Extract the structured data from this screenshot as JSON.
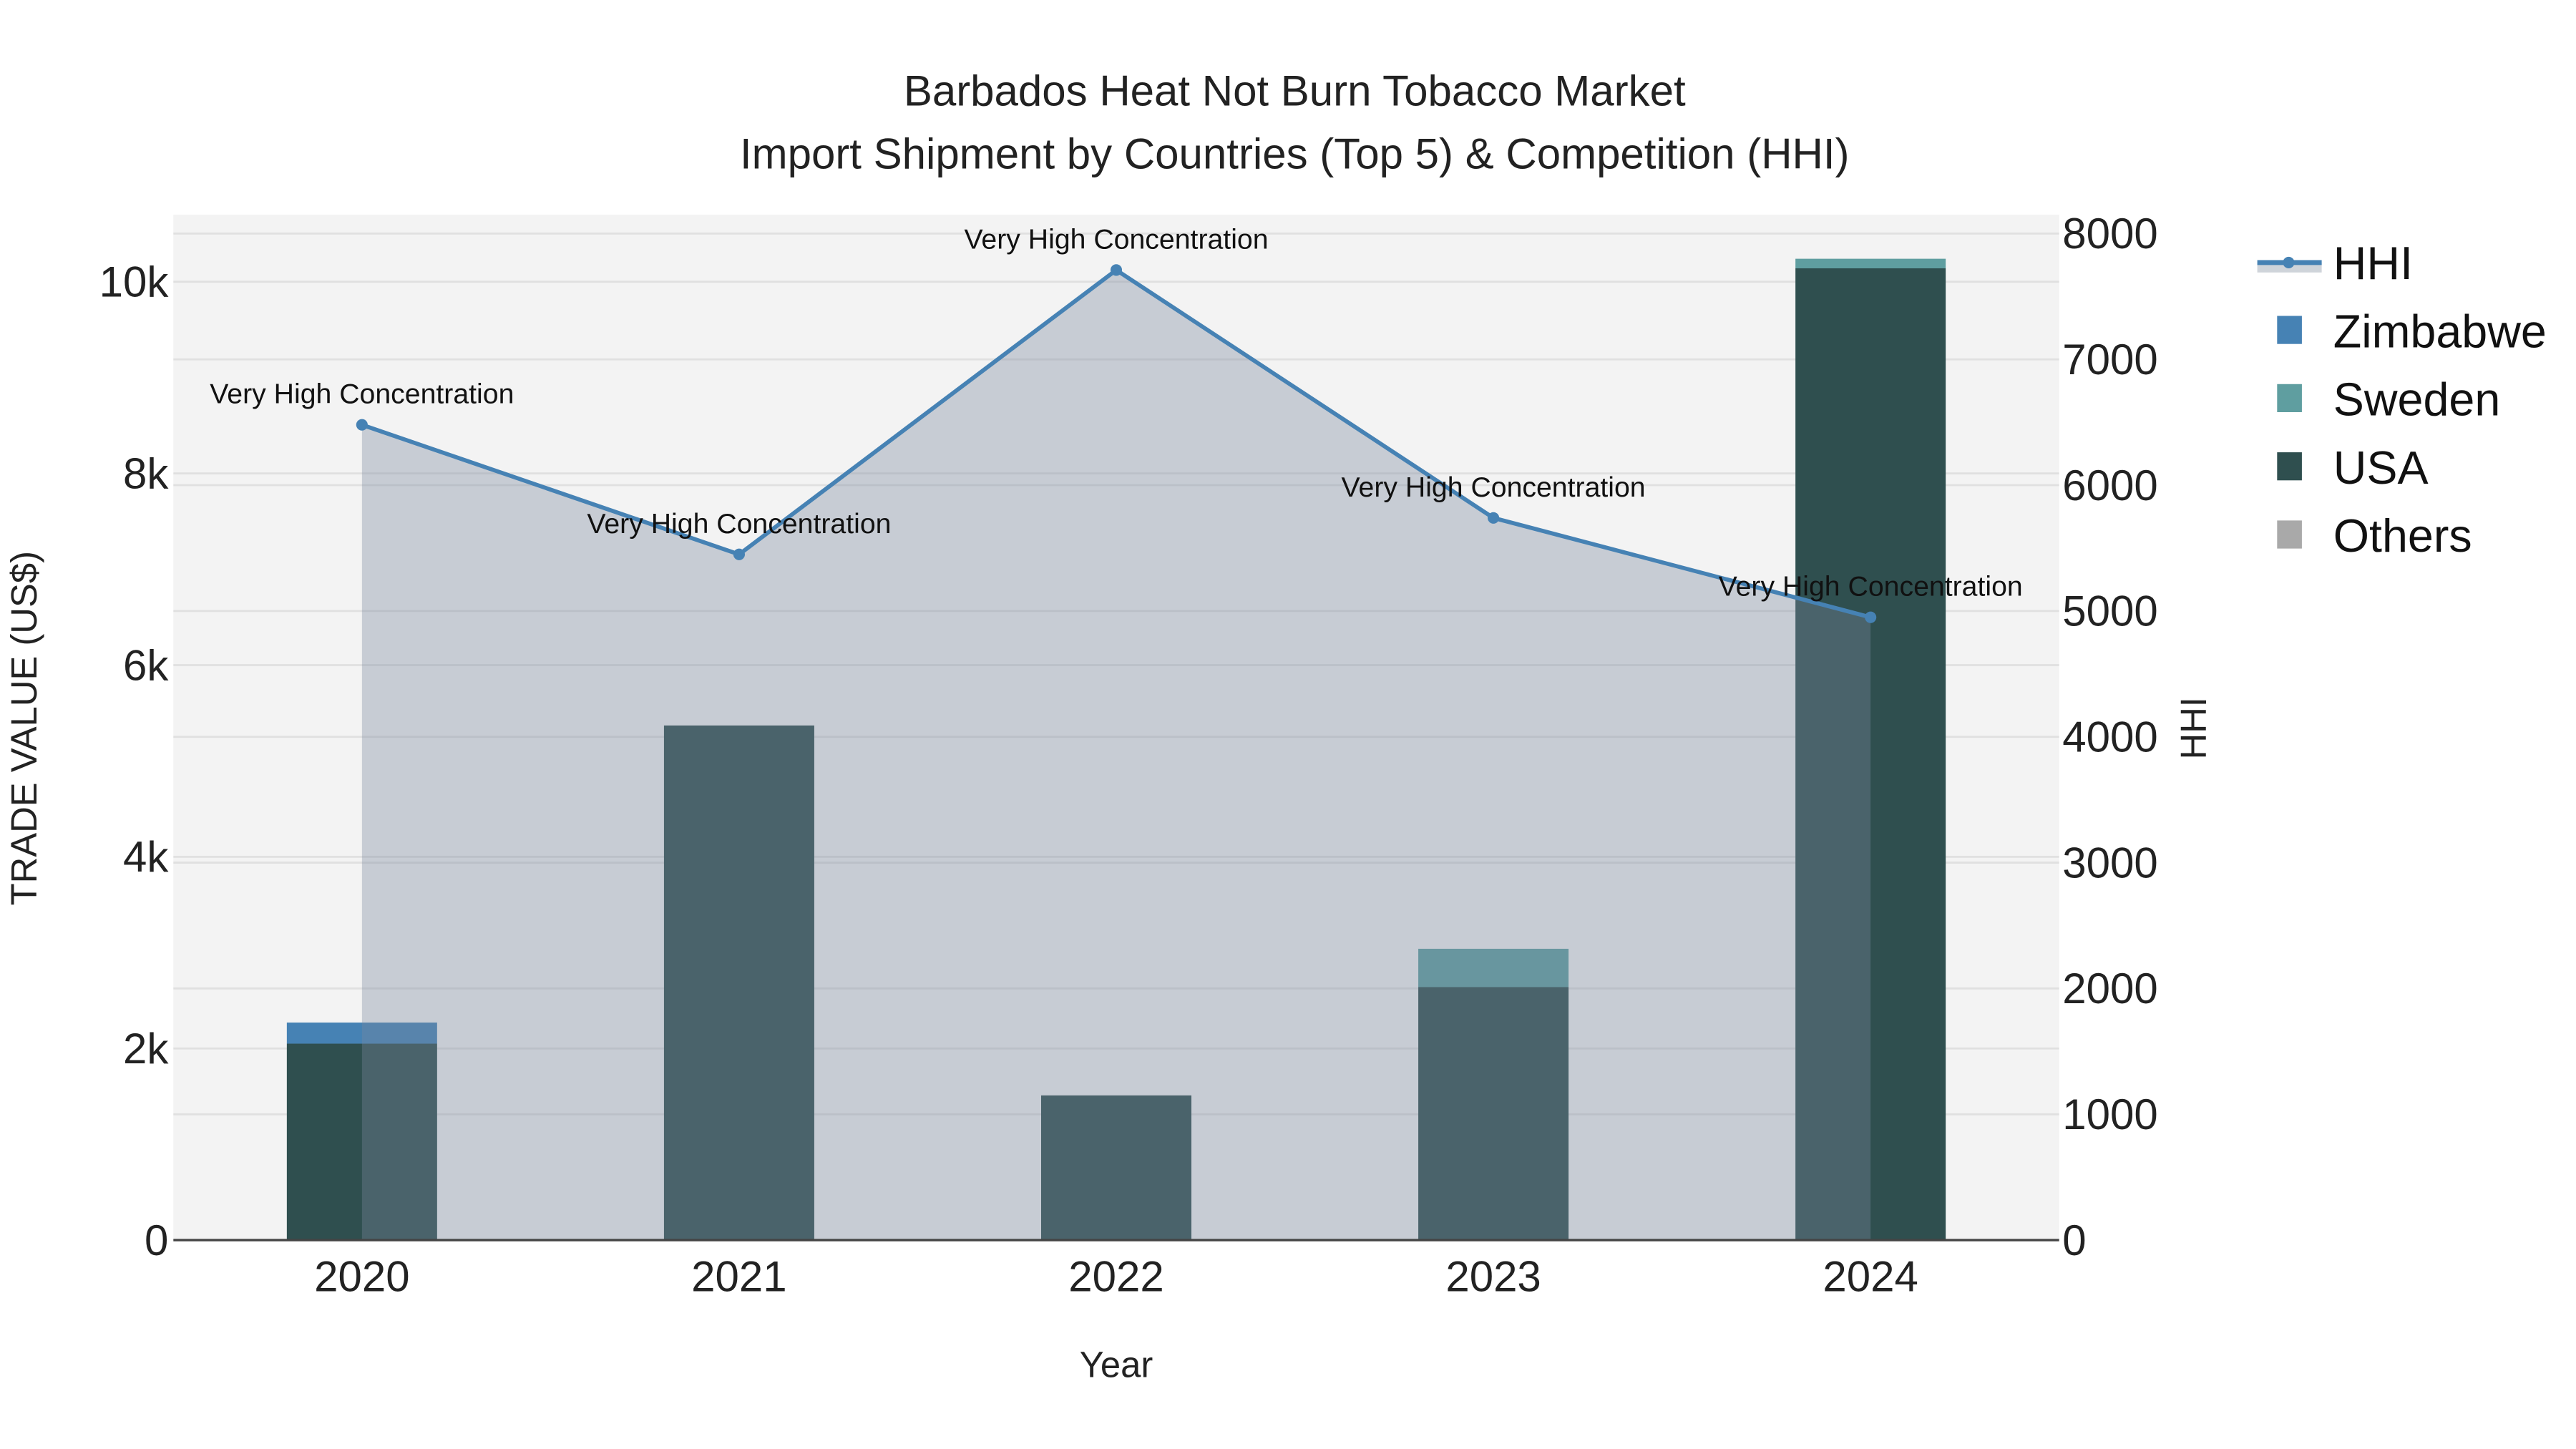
{
  "chart_data": {
    "type": "bar",
    "title_line1": "Barbados Heat Not Burn Tobacco Market",
    "title_line2": "Import Shipment by Countries (Top 5) & Competition (HHI)",
    "xlabel": "Year",
    "ylabel": "TRADE VALUE (US$)",
    "y2label": "HHI",
    "categories": [
      "2020",
      "2021",
      "2022",
      "2023",
      "2024"
    ],
    "ylim": [
      0,
      10700
    ],
    "y_ticks": [
      0,
      2000,
      4000,
      6000,
      8000,
      10000
    ],
    "y_tick_labels": [
      "0",
      "2k",
      "4k",
      "6k",
      "8k",
      "10k"
    ],
    "y2lim": [
      0,
      8150
    ],
    "y2_ticks": [
      0,
      1000,
      2000,
      3000,
      4000,
      5000,
      6000,
      7000,
      8000
    ],
    "y2_tick_labels": [
      "0",
      "1000",
      "2000",
      "3000",
      "4000",
      "5000",
      "6000",
      "7000",
      "8000"
    ],
    "barmode": "stack",
    "series": [
      {
        "name": "USA",
        "color": "#2f4f4f",
        "values": [
          2050,
          5370,
          1510,
          2640,
          10140
        ]
      },
      {
        "name": "Sweden",
        "color": "#5f9ea0",
        "values": [
          0,
          0,
          0,
          400,
          100
        ]
      },
      {
        "name": "Zimbabwe",
        "color": "#4682b4",
        "values": [
          220,
          0,
          0,
          0,
          0
        ]
      },
      {
        "name": "Others",
        "color": "#a9a9a9",
        "values": [
          0,
          0,
          0,
          0,
          0
        ]
      }
    ],
    "line": {
      "name": "HHI",
      "color": "#4682b4",
      "values": [
        6480,
        5450,
        7710,
        5740,
        4950
      ],
      "annotations": [
        "Very High Concentration",
        "Very High Concentration",
        "Very High Concentration",
        "Very High Concentration",
        "Very High Concentration"
      ]
    },
    "legend": {
      "placement": "top-right",
      "items": [
        "HHI",
        "Zimbabwe",
        "Sweden",
        "USA",
        "Others"
      ]
    },
    "grid": true
  }
}
